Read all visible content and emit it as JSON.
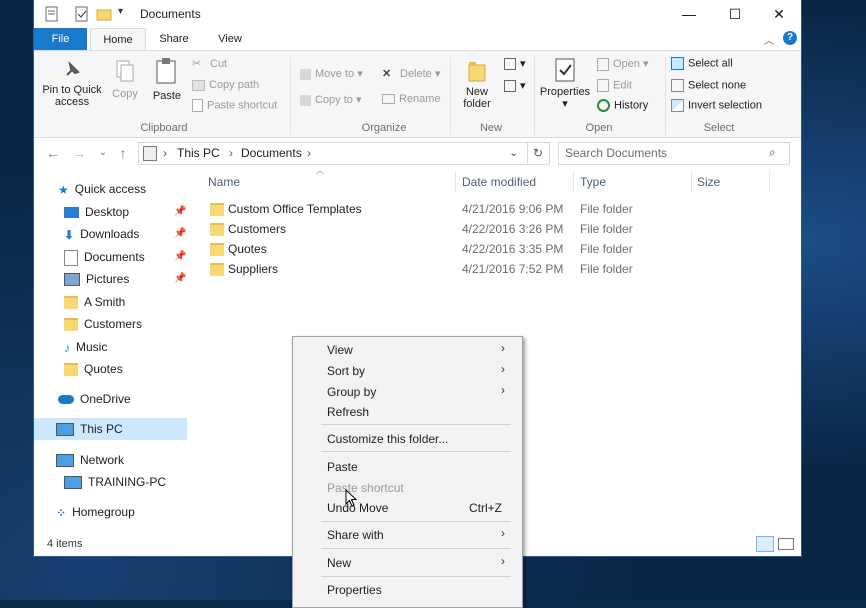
{
  "window": {
    "title": "Documents",
    "controls": {
      "minimize": "—",
      "maximize": "☐",
      "close": "✕"
    }
  },
  "ribbon": {
    "tabs": [
      {
        "label": "File"
      },
      {
        "label": "Home"
      },
      {
        "label": "Share"
      },
      {
        "label": "View"
      }
    ],
    "clipboard": {
      "pin": "Pin to Quick access",
      "copy": "Copy",
      "paste": "Paste",
      "cut": "Cut",
      "copy_path": "Copy path",
      "paste_shortcut": "Paste shortcut",
      "label": "Clipboard"
    },
    "organize": {
      "move_to": "Move to",
      "copy_to": "Copy to",
      "delete": "Delete",
      "rename": "Rename",
      "label": "Organize"
    },
    "new": {
      "new_folder": "New folder",
      "label": "New"
    },
    "open": {
      "properties": "Properties",
      "open": "Open",
      "edit": "Edit",
      "history": "History",
      "label": "Open"
    },
    "select": {
      "select_all": "Select all",
      "select_none": "Select none",
      "invert": "Invert selection",
      "label": "Select"
    }
  },
  "address": {
    "crumbs": [
      "This PC",
      "Documents"
    ],
    "search_placeholder": "Search Documents"
  },
  "nav": {
    "quick_access": "Quick access",
    "items": [
      {
        "label": "Desktop",
        "pinned": true
      },
      {
        "label": "Downloads",
        "pinned": true
      },
      {
        "label": "Documents",
        "pinned": true
      },
      {
        "label": "Pictures",
        "pinned": true
      },
      {
        "label": "A Smith",
        "pinned": false
      },
      {
        "label": "Customers",
        "pinned": false
      },
      {
        "label": "Music",
        "pinned": false
      },
      {
        "label": "Quotes",
        "pinned": false
      }
    ],
    "onedrive": "OneDrive",
    "this_pc": "This PC",
    "network": "Network",
    "training_pc": "TRAINING-PC",
    "homegroup": "Homegroup"
  },
  "columns": {
    "name": "Name",
    "date": "Date modified",
    "type": "Type",
    "size": "Size"
  },
  "files": [
    {
      "name": "Custom Office Templates",
      "date": "4/21/2016 9:06 PM",
      "type": "File folder"
    },
    {
      "name": "Customers",
      "date": "4/22/2016 3:26 PM",
      "type": "File folder"
    },
    {
      "name": "Quotes",
      "date": "4/22/2016 3:35 PM",
      "type": "File folder"
    },
    {
      "name": "Suppliers",
      "date": "4/21/2016 7:52 PM",
      "type": "File folder"
    }
  ],
  "status": "4 items",
  "context_menu": {
    "view": "View",
    "sort_by": "Sort by",
    "group_by": "Group by",
    "refresh": "Refresh",
    "customize": "Customize this folder...",
    "paste": "Paste",
    "paste_shortcut": "Paste shortcut",
    "undo_move": "Undo Move",
    "undo_shortcut": "Ctrl+Z",
    "share_with": "Share with",
    "new": "New",
    "properties": "Properties"
  },
  "colors": {
    "file_tab": "#1979ca",
    "selection": "#cce8ff",
    "folder": "#f8d775"
  }
}
